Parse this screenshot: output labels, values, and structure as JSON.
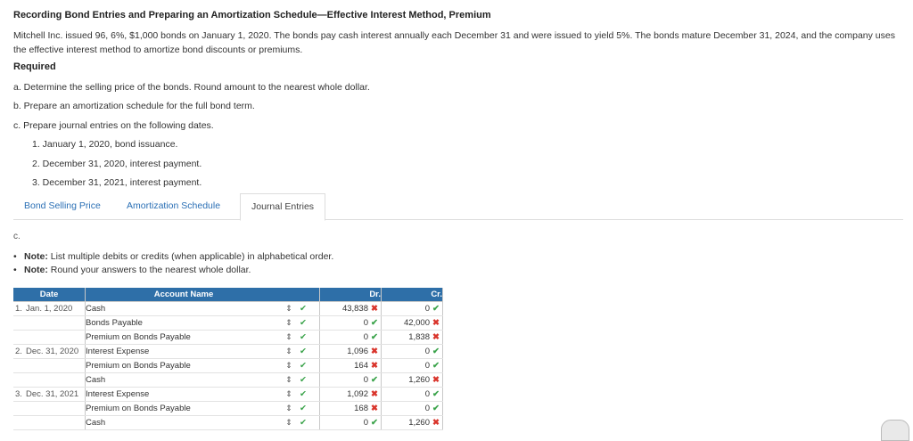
{
  "title": "Recording Bond Entries and Preparing an Amortization Schedule—Effective Interest Method, Premium",
  "intro": "Mitchell Inc. issued 96, 6%, $1,000 bonds on January 1, 2020. The bonds pay cash interest annually each December 31 and were issued to yield 5%. The bonds mature December 31, 2024, and the company uses the effective interest method to amortize bond discounts or premiums.",
  "required_label": "Required",
  "parts": {
    "a": "a. Determine the selling price of the bonds. Round amount to the nearest whole dollar.",
    "b": "b. Prepare an amortization schedule for the full bond term.",
    "c": "c. Prepare journal entries on the following dates.",
    "c1": "1. January 1, 2020, bond issuance.",
    "c2": "2. December 31, 2020, interest payment.",
    "c3": "3. December 31, 2021, interest payment."
  },
  "tabs": [
    "Bond Selling Price",
    "Amortization Schedule",
    "Journal Entries"
  ],
  "section_label": "c.",
  "notes": [
    {
      "label": "Note:",
      "text": " List multiple debits or credits (when applicable) in alphabetical order."
    },
    {
      "label": "Note:",
      "text": " Round your answers to the nearest whole dollar."
    }
  ],
  "table": {
    "headers": {
      "date": "Date",
      "account": "Account Name",
      "dr": "Dr.",
      "cr": "Cr."
    },
    "select_icon": "⇕",
    "check_icon": "✔",
    "rows": [
      {
        "num": "1.",
        "date": "Jan. 1, 2020",
        "account": "Cash",
        "indent": 0,
        "dr": "43,838",
        "dr_status": "bad",
        "cr": "0",
        "cr_status": "ok"
      },
      {
        "num": "",
        "date": "",
        "account": "Bonds Payable",
        "indent": 1,
        "dr": "0",
        "dr_status": "ok",
        "cr": "42,000",
        "cr_status": "bad"
      },
      {
        "num": "",
        "date": "",
        "account": "Premium on Bonds Payable",
        "indent": 1,
        "dr": "0",
        "dr_status": "ok",
        "cr": "1,838",
        "cr_status": "bad"
      },
      {
        "num": "2.",
        "date": "Dec. 31, 2020",
        "account": "Interest Expense",
        "indent": 0,
        "dr": "1,096",
        "dr_status": "bad",
        "cr": "0",
        "cr_status": "ok"
      },
      {
        "num": "",
        "date": "",
        "account": "Premium on Bonds Payable",
        "indent": 0,
        "dr": "164",
        "dr_status": "bad",
        "cr": "0",
        "cr_status": "ok"
      },
      {
        "num": "",
        "date": "",
        "account": "Cash",
        "indent": 1,
        "dr": "0",
        "dr_status": "ok",
        "cr": "1,260",
        "cr_status": "bad"
      },
      {
        "num": "3.",
        "date": "Dec. 31, 2021",
        "account": "Interest Expense",
        "indent": 0,
        "dr": "1,092",
        "dr_status": "bad",
        "cr": "0",
        "cr_status": "ok"
      },
      {
        "num": "",
        "date": "",
        "account": "Premium on Bonds Payable",
        "indent": 0,
        "dr": "168",
        "dr_status": "bad",
        "cr": "0",
        "cr_status": "ok"
      },
      {
        "num": "",
        "date": "",
        "account": "Cash",
        "indent": 1,
        "dr": "0",
        "dr_status": "ok",
        "cr": "1,260",
        "cr_status": "bad"
      }
    ]
  },
  "status_symbols": {
    "ok": "✔",
    "bad": "✖"
  },
  "colors": {
    "header_bg": "#2e6fa8",
    "link": "#2a6fb5",
    "correct": "#3aa34a",
    "incorrect": "#d9342b"
  }
}
